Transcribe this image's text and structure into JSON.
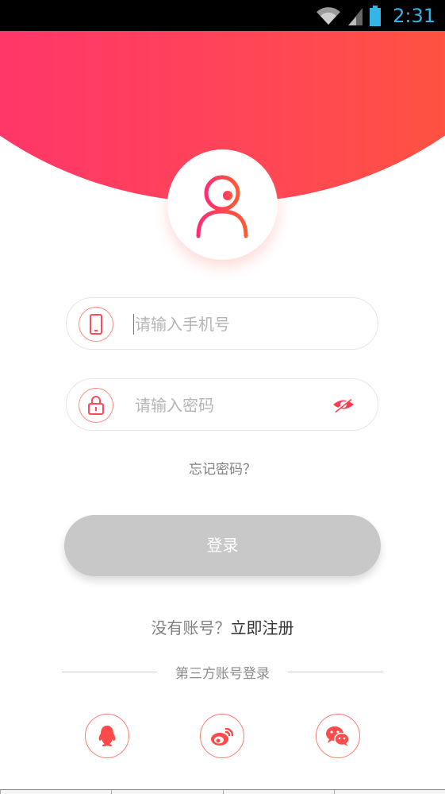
{
  "status_bar": {
    "time": "2:31"
  },
  "login": {
    "phone_placeholder": "请输入手机号",
    "password_placeholder": "请输入密码",
    "forgot_password": "忘记密码？",
    "login_button": "登录",
    "no_account": "没有账号？",
    "register_link": "立即注册",
    "third_party_title": "第三方账号登录"
  },
  "icons": {
    "avatar": "user-icon",
    "phone": "phone-icon",
    "lock": "lock-icon",
    "eye": "eye-hidden-icon",
    "qq": "qq-icon",
    "weibo": "weibo-icon",
    "wechat": "wechat-icon"
  },
  "colors": {
    "gradient_start": "#ff2e73",
    "gradient_end": "#ff5a33",
    "login_button_disabled": "#c8c8c8",
    "status_time": "#33b5e5"
  }
}
